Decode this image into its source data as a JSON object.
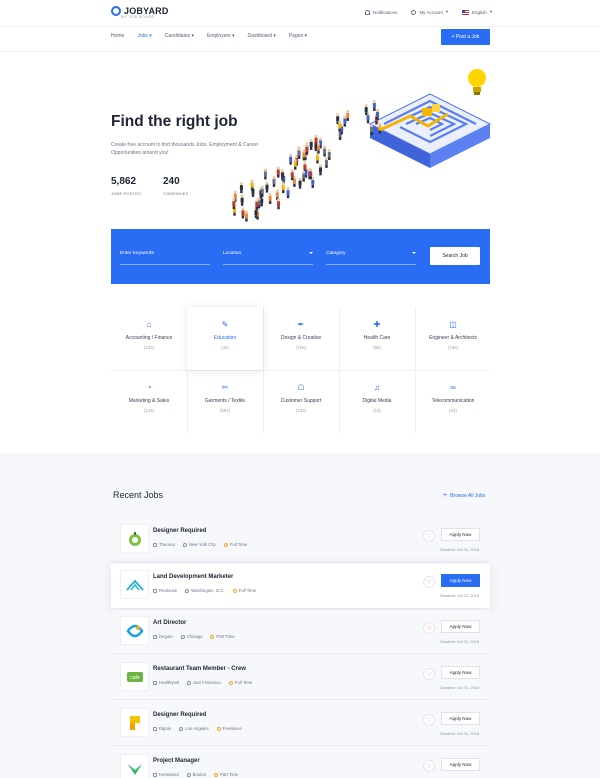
{
  "header": {
    "logo_text": "JOBYARD",
    "logo_sub": "MY JOB BOARD",
    "notifications_label": "Notifications",
    "account_label": "My Account",
    "language_label": "English",
    "nav": [
      "Home",
      "Jobs",
      "Candidates",
      "Employers",
      "Dashboard",
      "Pages"
    ],
    "active_nav": "Jobs",
    "post_job_label": "+ Post a Job"
  },
  "hero": {
    "title": "Find the right job",
    "description": "Create free account to find thousands Jobs, Employment & Career Opportunities around you!",
    "stats": [
      {
        "value": "5,862",
        "label": "JOBS POSTED"
      },
      {
        "value": "240",
        "label": "COMPANIES"
      }
    ]
  },
  "search": {
    "keywords_placeholder": "Enter Keywords",
    "location_label": "Location",
    "category_label": "Category",
    "button_label": "Search Job"
  },
  "categories": [
    {
      "name": "Accounting / Finance",
      "count": "(233)",
      "icon": "bank-icon"
    },
    {
      "name": "Education",
      "count": "(46)",
      "icon": "pencil-icon"
    },
    {
      "name": "Design & Creative",
      "count": "(156)",
      "icon": "pen-tool-icon"
    },
    {
      "name": "Health Care",
      "count": "(98)",
      "icon": "medical-kit-icon"
    },
    {
      "name": "Engineer & Architects",
      "count": "(188)",
      "icon": "cube-icon"
    },
    {
      "name": "Marketing & Sales",
      "count": "(124)",
      "icon": "pie-chart-icon"
    },
    {
      "name": "Garments / Textile",
      "count": "(584)",
      "icon": "scissors-icon"
    },
    {
      "name": "Customer Support",
      "count": "(233)",
      "icon": "headset-box-icon"
    },
    {
      "name": "Digital Media",
      "count": "(15)",
      "icon": "headphones-icon"
    },
    {
      "name": "Telecommunication",
      "count": "(03)",
      "icon": "glasses-icon"
    }
  ],
  "selected_category": "Education",
  "recent_jobs": {
    "title": "Recent Jobs",
    "browse_label": "Browse All Jobs",
    "apply_label": "Apply Now",
    "items": [
      {
        "title": "Designer Required",
        "company": "Theoreo",
        "location": "New York City",
        "type": "Full Time",
        "deadline": "Deadline: Oct 31, 2018",
        "logo": "lime-logo",
        "favorited": false,
        "featured": false
      },
      {
        "title": "Land Development Marketer",
        "company": "Realouse",
        "location": "Washington, D.C.",
        "type": "Full Time",
        "deadline": "Deadline: Oct 31, 2018",
        "logo": "mountain-logo",
        "favorited": false,
        "featured": true
      },
      {
        "title": "Art Director",
        "company": "Degoin",
        "location": "Chicago",
        "type": "Part Time",
        "deadline": "Deadline: Oct 31, 2018",
        "logo": "ring-logo",
        "favorited": true,
        "featured": false
      },
      {
        "title": "Restaurant Team Member - Crew",
        "company": "Healthyest",
        "location": "San Francisco",
        "type": "Full Time",
        "deadline": "Deadline: Oct 31, 2018",
        "logo": "cafe-logo",
        "favorited": false,
        "featured": false
      },
      {
        "title": "Designer Required",
        "company": "Digoin",
        "location": "Los Angeles",
        "type": "Freelance",
        "deadline": "Deadline: Oct 31, 2018",
        "logo": "pencil-logo",
        "favorited": false,
        "featured": false
      },
      {
        "title": "Project Manager",
        "company": "Homeland",
        "location": "Boston",
        "type": "Part Time",
        "deadline": "Deadline: Oct 31, 2018",
        "logo": "leaf-logo",
        "favorited": false,
        "featured": false
      }
    ]
  },
  "colors": {
    "accent": "#2a6df5",
    "heading": "#1d2433",
    "muted": "#6a7488",
    "section_bg": "#f6f8fb",
    "favorite": "#e5484d"
  }
}
